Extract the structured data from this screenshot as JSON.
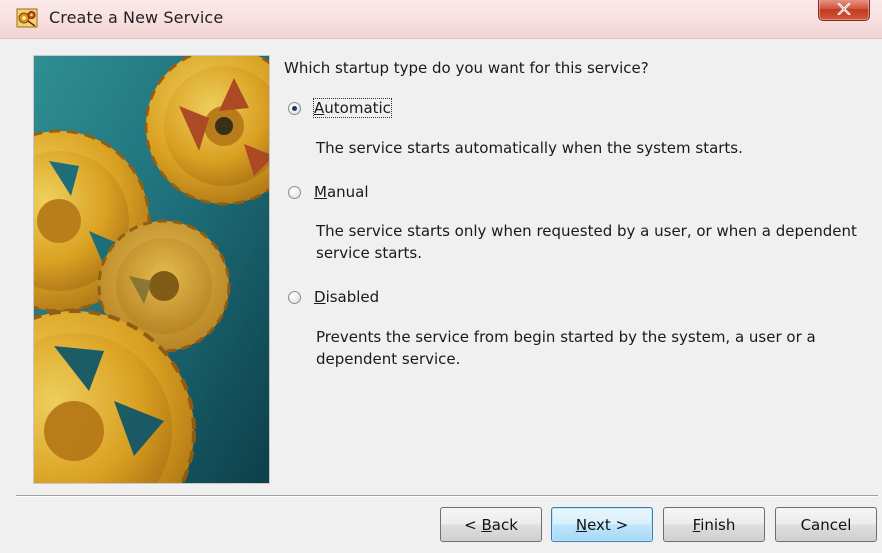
{
  "window": {
    "title": "Create a New Service",
    "app_icon": "service-wizard-icon",
    "close_icon": "close-icon"
  },
  "wizard": {
    "question": "Which startup type do you want for this service?",
    "options": [
      {
        "pre": "",
        "mnemonic": "A",
        "post": "utomatic",
        "description": "The service starts automatically when the system starts.",
        "selected": true,
        "focused": true
      },
      {
        "pre": "",
        "mnemonic": "M",
        "post": "anual",
        "description": "The service starts only when requested by a user, or when a dependent service starts.",
        "selected": false,
        "focused": false
      },
      {
        "pre": "",
        "mnemonic": "D",
        "post": "isabled",
        "description": "Prevents the service from begin started by the system, a user or a dependent service.",
        "selected": false,
        "focused": false
      }
    ]
  },
  "buttons": {
    "back": {
      "pre": "< ",
      "mnemonic": "B",
      "post": "ack"
    },
    "next": {
      "pre": "",
      "mnemonic": "N",
      "post": "ext >"
    },
    "finish": {
      "pre": "",
      "mnemonic": "F",
      "post": "inish"
    },
    "cancel": {
      "pre": "",
      "mnemonic": "",
      "post": "Cancel"
    }
  },
  "colors": {
    "titlebar": "#f7dede",
    "close_button": "#c8452d",
    "dialog_background": "#f0f0f0",
    "gear_gold": "#e8a81c",
    "gear_teal": "#1f6f7a"
  }
}
